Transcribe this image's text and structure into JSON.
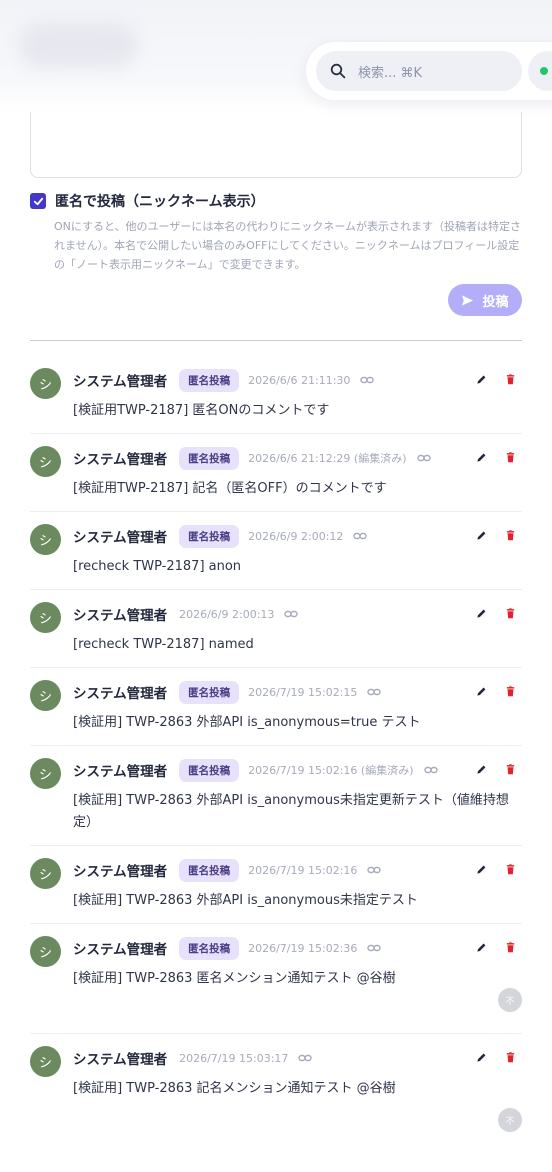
{
  "header": {
    "search_placeholder": "検索... ⌘K"
  },
  "composer": {
    "anonymous_checked": true,
    "anonymous_label": "匿名で投稿（ニックネーム表示）",
    "anonymous_help": "ONにすると、他のユーザーには本名の代わりにニックネームが表示されます（投稿者は特定されません）。本名で公開したい場合のみOFFにしてください。ニックネームはプロフィール設定の「ノート表示用ニックネーム」で変更できます。",
    "post_label": "投稿"
  },
  "comments": [
    {
      "avatar": "シ",
      "author": "システム管理者",
      "badge": "匿名投稿",
      "timestamp": "2026/6/6 21:11:30",
      "body": "[検証用TWP-2187] 匿名ONのコメントです"
    },
    {
      "avatar": "シ",
      "author": "システム管理者",
      "badge": "匿名投稿",
      "timestamp": "2026/6/6 21:12:29 (編集済み)",
      "body": "[検証用TWP-2187] 記名（匿名OFF）のコメントです"
    },
    {
      "avatar": "シ",
      "author": "システム管理者",
      "badge": "匿名投稿",
      "timestamp": "2026/6/9 2:00:12",
      "body": "[recheck TWP-2187] anon"
    },
    {
      "avatar": "シ",
      "author": "システム管理者",
      "badge": "",
      "timestamp": "2026/6/9 2:00:13",
      "body": "[recheck TWP-2187] named"
    },
    {
      "avatar": "シ",
      "author": "システム管理者",
      "badge": "匿名投稿",
      "timestamp": "2026/7/19 15:02:15",
      "body": "[検証用] TWP-2863 外部API is_anonymous=true テスト"
    },
    {
      "avatar": "シ",
      "author": "システム管理者",
      "badge": "匿名投稿",
      "timestamp": "2026/7/19 15:02:16 (編集済み)",
      "body": "[検証用] TWP-2863 外部API is_anonymous未指定更新テスト（値維持想定）"
    },
    {
      "avatar": "シ",
      "author": "システム管理者",
      "badge": "匿名投稿",
      "timestamp": "2026/7/19 15:02:16",
      "body": "[検証用] TWP-2863 外部API is_anonymous未指定テスト"
    },
    {
      "avatar": "シ",
      "author": "システム管理者",
      "badge": "匿名投稿",
      "timestamp": "2026/7/19 15:02:36",
      "body": "[検証用] TWP-2863 匿名メンション通知テスト @谷樹",
      "reaction": "不"
    },
    {
      "avatar": "シ",
      "author": "システム管理者",
      "badge": "",
      "timestamp": "2026/7/19 15:03:17",
      "body": "[検証用] TWP-2863 記名メンション通知テスト @谷樹",
      "reaction": "不"
    }
  ],
  "colors": {
    "accent": "#4338ca",
    "badge_bg": "#e7e1fb",
    "avatar_bg": "#6b8a5f",
    "delete_icon": "#e0242d",
    "post_button": "#b3aef7"
  }
}
